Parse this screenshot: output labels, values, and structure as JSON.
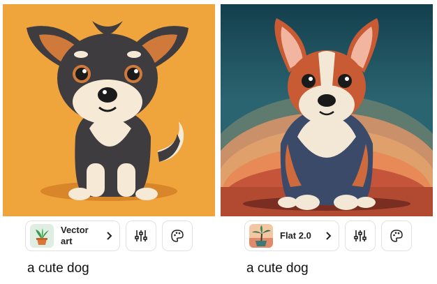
{
  "results": [
    {
      "image_alt": "cartoon gray and cream dog sitting on orange background",
      "style_label": "Vector art",
      "style_thumb_icon": "potted-plant-thumbnail",
      "adjust_icon": "sliders-icon",
      "palette_icon": "palette-icon",
      "caption": "a cute dog"
    },
    {
      "image_alt": "flat illustration of a corgi puppy on a colorful sunset background",
      "style_label": "Flat 2.0",
      "style_thumb_icon": "palm-tree-thumbnail",
      "adjust_icon": "sliders-icon",
      "palette_icon": "palette-icon",
      "caption": "a cute dog"
    }
  ],
  "colors": {
    "left_bg": "#f0a43c",
    "right_bg_top": "#1d5160",
    "border": "#e2e2e2"
  }
}
